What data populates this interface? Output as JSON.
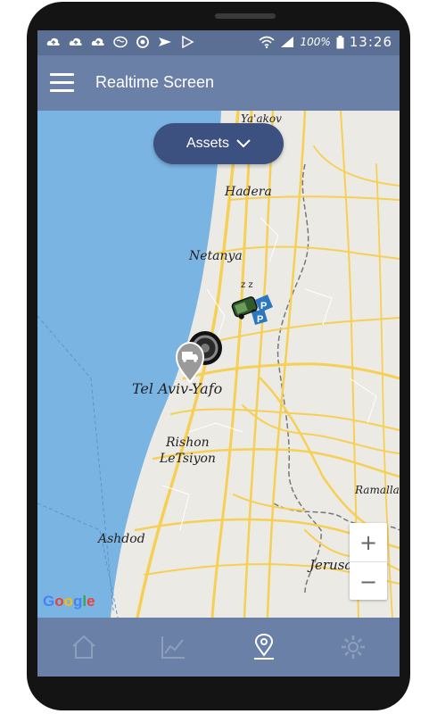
{
  "statusbar": {
    "battery": "100%",
    "time": "13:26"
  },
  "appbar": {
    "title": "Realtime Screen"
  },
  "filter": {
    "label": "Assets"
  },
  "map": {
    "labels": {
      "yakov": "Ya'akov",
      "hadera": "Hadera",
      "netanya": "Netanya",
      "telaviv": "Tel Aviv-Yafo",
      "rishon1": "Rishon",
      "rishon2": "LeTsiyon",
      "ashdod": "Ashdod",
      "ramalla": "Ramalla",
      "jerusalem": "Jerusalem"
    },
    "attribution": "Google",
    "zoom_in": "+",
    "zoom_out": "−"
  },
  "vehicles": {
    "sleeping_marker": "Z Z",
    "parking_marker": "P"
  },
  "nav": {
    "items": [
      "home-icon",
      "chart-icon",
      "location-pin-icon",
      "gear-icon"
    ],
    "active": "location-pin-icon"
  },
  "colors": {
    "appbar": "#6a80a7",
    "statusbar": "#5a6f93",
    "assets_button": "#3c5180",
    "sea": "#7ab4e2",
    "land": "#eceae5",
    "roads": "#f6cf55"
  }
}
